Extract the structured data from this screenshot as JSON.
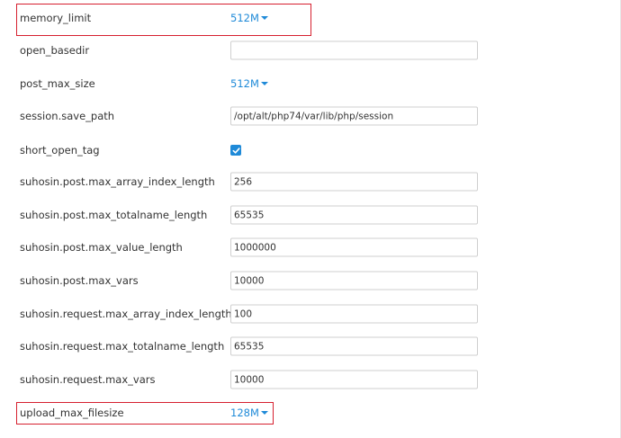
{
  "settings": [
    {
      "name": "memory_limit",
      "type": "dropdown",
      "value": "512M"
    },
    {
      "name": "open_basedir",
      "type": "text",
      "value": ""
    },
    {
      "name": "post_max_size",
      "type": "dropdown",
      "value": "512M"
    },
    {
      "name": "session.save_path",
      "type": "text",
      "value": "/opt/alt/php74/var/lib/php/session"
    },
    {
      "name": "short_open_tag",
      "type": "checkbox",
      "checked": true
    },
    {
      "name": "suhosin.post.max_array_index_length",
      "type": "text",
      "value": "256"
    },
    {
      "name": "suhosin.post.max_totalname_length",
      "type": "text",
      "value": "65535"
    },
    {
      "name": "suhosin.post.max_value_length",
      "type": "text",
      "value": "1000000"
    },
    {
      "name": "suhosin.post.max_vars",
      "type": "text",
      "value": "10000"
    },
    {
      "name": "suhosin.request.max_array_index_length",
      "type": "text",
      "value": "100"
    },
    {
      "name": "suhosin.request.max_totalname_length",
      "type": "text",
      "value": "65535"
    },
    {
      "name": "suhosin.request.max_vars",
      "type": "text",
      "value": "10000"
    },
    {
      "name": "upload_max_filesize",
      "type": "dropdown",
      "value": "128M"
    }
  ],
  "colors": {
    "accent": "#1f8ad8",
    "highlight": "#d6202f"
  },
  "icons": {
    "dropdown": "caret-down-icon",
    "checkbox": "checkmark-icon"
  }
}
